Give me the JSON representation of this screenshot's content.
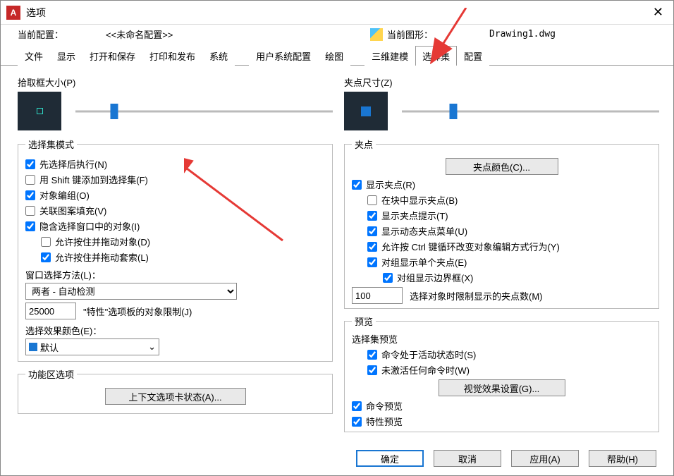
{
  "window": {
    "title": "选项"
  },
  "info": {
    "profile_label": "当前配置：",
    "profile_value": "<<未命名配置>>",
    "drawing_label": "当前图形：",
    "drawing_value": "Drawing1.dwg"
  },
  "tabs": [
    "文件",
    "显示",
    "打开和保存",
    "打印和发布",
    "系统",
    "用户系统配置",
    "绘图",
    "三维建模",
    "选择集",
    "配置"
  ],
  "tabs_active": 8,
  "left": {
    "pickbox_label": "拾取框大小(P)",
    "mode_legend": "选择集模式",
    "cb_prepick": "先选择后执行(N)",
    "cb_shift": "用 Shift 键添加到选择集(F)",
    "cb_group": "对象编组(O)",
    "cb_hatch": "关联图案填充(V)",
    "cb_implied": "隐含选择窗口中的对象(I)",
    "cb_dragobj": "允许按住并拖动对象(D)",
    "cb_draglasso": "允许按住并拖动套索(L)",
    "winmethod_label": "窗口选择方法(L)：",
    "winmethod_value": "两者 - 自动检测",
    "limit_value": "25000",
    "limit_label": "\"特性\"选项板的对象限制(J)",
    "effcolor_label": "选择效果颜色(E)：",
    "effcolor_value": "默认",
    "ribbon_legend": "功能区选项",
    "ribbon_btn": "上下文选项卡状态(A)..."
  },
  "right": {
    "gripsize_label": "夹点尺寸(Z)",
    "grips_legend": "夹点",
    "gripcolor_btn": "夹点颜色(C)...",
    "cb_showgrips": "显示夹点(R)",
    "cb_blockgrips": "在块中显示夹点(B)",
    "cb_griptips": "显示夹点提示(T)",
    "cb_dyngrip": "显示动态夹点菜单(U)",
    "cb_ctrlcycle": "允许按 Ctrl 键循环改变对象编辑方式行为(Y)",
    "cb_groupsingle": "对组显示单个夹点(E)",
    "cb_groupbbox": "对组显示边界框(X)",
    "griplimit_value": "100",
    "griplimit_label": "选择对象时限制显示的夹点数(M)",
    "preview_legend": "预览",
    "preview_sub": "选择集预览",
    "cb_active": "命令处于活动状态时(S)",
    "cb_noactive": "未激活任何命令时(W)",
    "vfx_btn": "视觉效果设置(G)...",
    "cb_cmdpreview": "命令预览",
    "cb_proppreview": "特性预览"
  },
  "footer": {
    "ok": "确定",
    "cancel": "取消",
    "apply": "应用(A)",
    "help": "帮助(H)"
  }
}
